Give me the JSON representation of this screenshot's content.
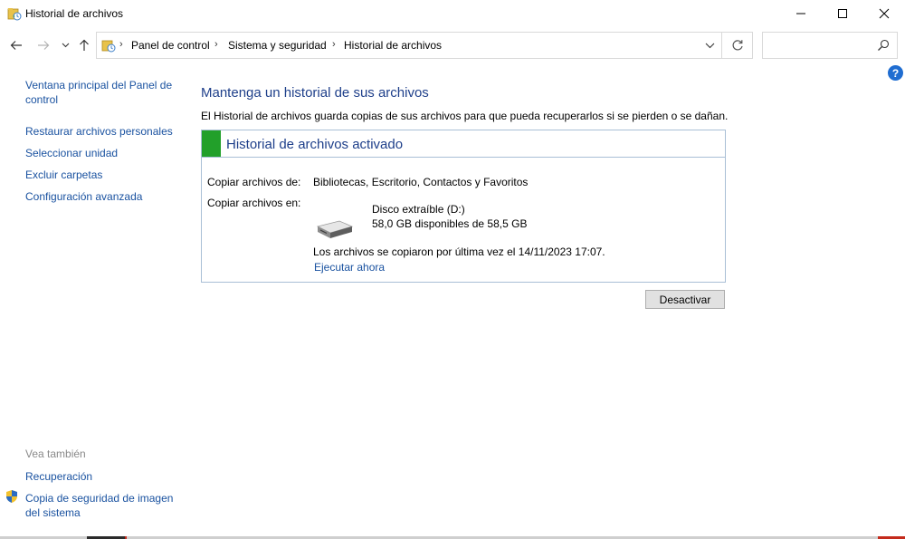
{
  "window": {
    "title": "Historial de archivos"
  },
  "address": {
    "crumbs": [
      "Panel de control",
      "Sistema y seguridad",
      "Historial de archivos"
    ],
    "search_placeholder": ""
  },
  "left_pane": {
    "links": [
      "Ventana principal del Panel de control",
      "Restaurar archivos personales",
      "Seleccionar unidad",
      "Excluir carpetas",
      "Configuración avanzada"
    ],
    "see_also_heading": "Vea también",
    "see_also": [
      "Recuperación",
      "Copia de seguridad de imagen del sistema"
    ]
  },
  "main": {
    "heading": "Mantenga un historial de sus archivos",
    "description": "El Historial de archivos guarda copias de sus archivos para que pueda recuperarlos si se pierden o se dañan.",
    "status_title": "Historial de archivos activado",
    "status_color": "#22a02a",
    "copy_from_label": "Copiar archivos de:",
    "copy_from_value": "Bibliotecas, Escritorio, Contactos y Favoritos",
    "copy_to_label": "Copiar archivos en:",
    "drive_name": "Disco extraíble (D:)",
    "drive_space": "58,0 GB disponibles de 58,5 GB",
    "last_copy": "Los archivos se copiaron por última vez el 14/11/2023 17:07.",
    "run_now": "Ejecutar ahora",
    "deactivate_button": "Desactivar"
  },
  "colors": {
    "link": "#1a52a0",
    "heading": "#1e3f8a",
    "help": "#1f6dd1"
  },
  "help_label": "?"
}
